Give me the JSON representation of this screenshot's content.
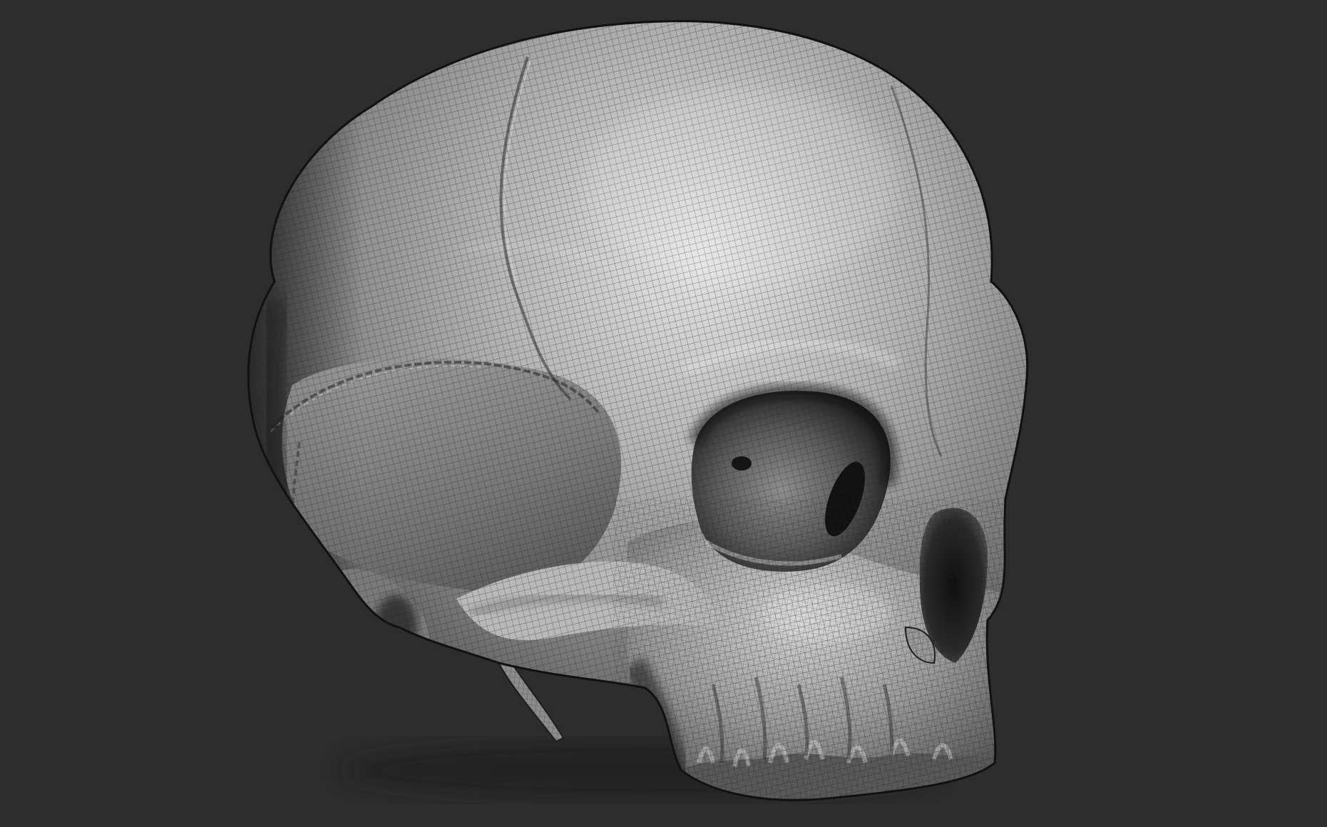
{
  "scene": {
    "background_color": "#2d2d2d",
    "model": "skull-mesh",
    "render_style": "wireframe-over-clay",
    "surface_color": "#9a9a9a",
    "highlight_color": "#e6e6e6",
    "shadow_color": "#161616",
    "wire_color": "#202020"
  }
}
